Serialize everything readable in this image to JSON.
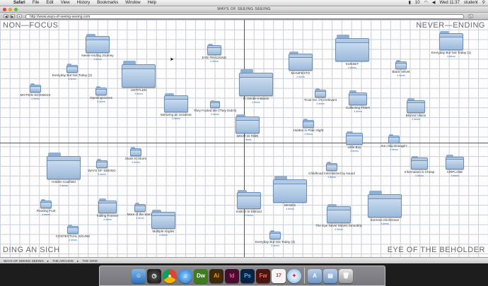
{
  "menubar": {
    "apple": "",
    "items": [
      "Safari",
      "File",
      "Edit",
      "View",
      "History",
      "Bookmarks",
      "Window",
      "Help"
    ],
    "battery": "10",
    "clock": "Wed 11:37",
    "user": "student"
  },
  "window": {
    "title": "WAYS OF SEEING SEEING",
    "url": "http://www.ways-of-seeing-seeing.com"
  },
  "corners": {
    "top_left": "NON—FOCUS",
    "top_right": "NEVER—ENDING",
    "bottom_left": "DING AN SICH",
    "bottom_right": "EYE OF THE BEHOLDER"
  },
  "folders": [
    {
      "name": "Never-ending Journey",
      "count": "4 items"
    },
    {
      "name": "EYE-TRACKING",
      "count": "4 items"
    },
    {
      "name": "MANIFESTO",
      "count": "4 items"
    },
    {
      "name": "SUNSET",
      "count": "4 items"
    },
    {
      "name": "Everyday But Not Today (1)",
      "count": "4 items"
    },
    {
      "name": "Everyday But Not Today (2)",
      "count": "4 items"
    },
    {
      "name": "UNTITLED",
      "count": "4 items"
    },
    {
      "name": "In Gentle Instants",
      "count": "4 items"
    },
    {
      "name": "Black Velvet",
      "count": "4 items"
    },
    {
      "name": "MOTION SICKNESS",
      "count": "4 items"
    },
    {
      "name": "Openingscenes",
      "count": "4 items"
    },
    {
      "name": "Trust me, it's irrelevant",
      "count": "4 items"
    },
    {
      "name": "Collecting Fitters",
      "count": "4 items"
    },
    {
      "name": "Mirroring an Universe",
      "count": "4 items"
    },
    {
      "name": "They Fooled Me (They Didn't)",
      "count": "4 items"
    },
    {
      "name": "Blurred Vision",
      "count": "4 items"
    },
    {
      "name": "Hidden in Plain Sight",
      "count": "4 items"
    },
    {
      "name": "WHAT IS TIME",
      "count": "4 items"
    },
    {
      "name": "Little Boy",
      "count": "4 items"
    },
    {
      "name": "Am I Nip Enough?",
      "count": "4 items"
    },
    {
      "name": "Stairs to Storm",
      "count": "4 items"
    },
    {
      "name": "Holden Caulfield",
      "count": "4 items"
    },
    {
      "name": "WAYS OF SEEING",
      "count": "4 items"
    },
    {
      "name": "Childhood Internalized by sound",
      "count": "4 items"
    },
    {
      "name": "Information is Cheap",
      "count": "4 items"
    },
    {
      "name": "AIRPLANE",
      "count": "4 items"
    },
    {
      "name": "More of the Same",
      "count": "4 items"
    },
    {
      "name": "Floating Fruit",
      "count": "4 items"
    },
    {
      "name": "Falling Forever",
      "count": "4 items"
    },
    {
      "name": "Instinct to Distract",
      "count": "4 items"
    },
    {
      "name": "MASKS",
      "count": "4 items"
    },
    {
      "name": "Extreme Kitchenear",
      "count": "4 items"
    },
    {
      "name": "Multiple Angles",
      "count": "4 items"
    },
    {
      "name": "The Eye Never Moves Smoothly",
      "count": "4 items"
    },
    {
      "name": "CONTEXTUAL SOUND",
      "count": "4 items"
    },
    {
      "name": "Everyday But Not Today (3)",
      "count": "4 items"
    }
  ],
  "pathbar": [
    "WAYS OF SEEING SEEING",
    "▸",
    "THE ARCHIVE",
    "▸",
    "THE GRID"
  ],
  "dock": {
    "items": [
      "Finder",
      "Dashboard",
      "Chrome",
      "iTunes",
      "Dw",
      "Ai",
      "Id",
      "Ps",
      "Fw",
      "iCal",
      "Safari",
      "Applications",
      "Documents",
      "Trash"
    ],
    "labels": [
      "Dw",
      "Ai",
      "Id",
      "Ps",
      "Fw"
    ],
    "colors": {
      "dreamweaver": "#3e7d1f",
      "illustrator": "#ff7c00",
      "indesign": "#d6237a",
      "photoshop": "#0e6bbf",
      "fireworks": "#c23a2e"
    }
  }
}
